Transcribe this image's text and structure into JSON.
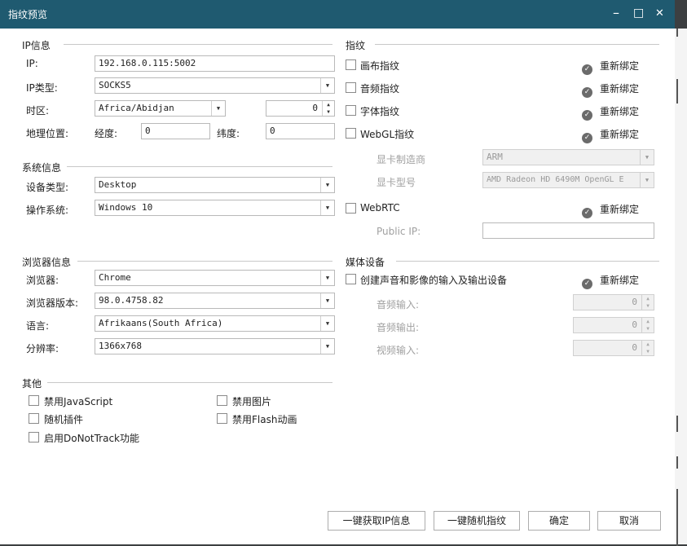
{
  "window": {
    "title": "指纹预览",
    "minimize": "–",
    "maximize": "□",
    "close": "✕"
  },
  "ip_info": {
    "heading": "IP信息",
    "ip_label": "IP:",
    "ip_value": "192.168.0.115:5002",
    "ip_type_label": "IP类型:",
    "ip_type_value": "SOCKS5",
    "timezone_label": "时区:",
    "timezone_value": "Africa/Abidjan",
    "timezone_offset": "0",
    "location_label": "地理位置:",
    "longitude_label": "经度:",
    "longitude_value": "0",
    "latitude_label": "纬度:",
    "latitude_value": "0"
  },
  "system_info": {
    "heading": "系统信息",
    "device_label": "设备类型:",
    "device_value": "Desktop",
    "os_label": "操作系统:",
    "os_value": "Windows 10"
  },
  "browser_info": {
    "heading": "浏览器信息",
    "browser_label": "浏览器:",
    "browser_value": "Chrome",
    "version_label": "浏览器版本:",
    "version_value": "98.0.4758.82",
    "language_label": "语言:",
    "language_value": "Afrikaans(South Africa)",
    "resolution_label": "分辨率:",
    "resolution_value": "1366x768"
  },
  "other": {
    "heading": "其他",
    "disable_js": "禁用JavaScript",
    "disable_images": "禁用图片",
    "random_plugins": "随机插件",
    "disable_flash": "禁用Flash动画",
    "enable_dnt": "启用DoNotTrack功能"
  },
  "fingerprint": {
    "heading": "指纹",
    "rebind": "重新绑定",
    "canvas": "画布指纹",
    "audio": "音频指纹",
    "font": "字体指纹",
    "webgl": "WebGL指纹",
    "gpu_vendor_label": "显卡制造商",
    "gpu_vendor_value": "ARM",
    "gpu_model_label": "显卡型号",
    "gpu_model_value": "AMD Radeon HD 6490M OpenGL E",
    "webrtc": "WebRTC",
    "public_ip_label": "Public IP:",
    "public_ip_value": ""
  },
  "media": {
    "heading": "媒体设备",
    "create_devices": "创建声音和影像的输入及输出设备",
    "rebind": "重新绑定",
    "audio_in_label": "音频输入:",
    "audio_in_value": "0",
    "audio_out_label": "音频输出:",
    "audio_out_value": "0",
    "video_in_label": "视频输入:",
    "video_in_value": "0"
  },
  "footer": {
    "get_ip": "一键获取IP信息",
    "random_fp": "一键随机指纹",
    "ok": "确定",
    "cancel": "取消"
  }
}
